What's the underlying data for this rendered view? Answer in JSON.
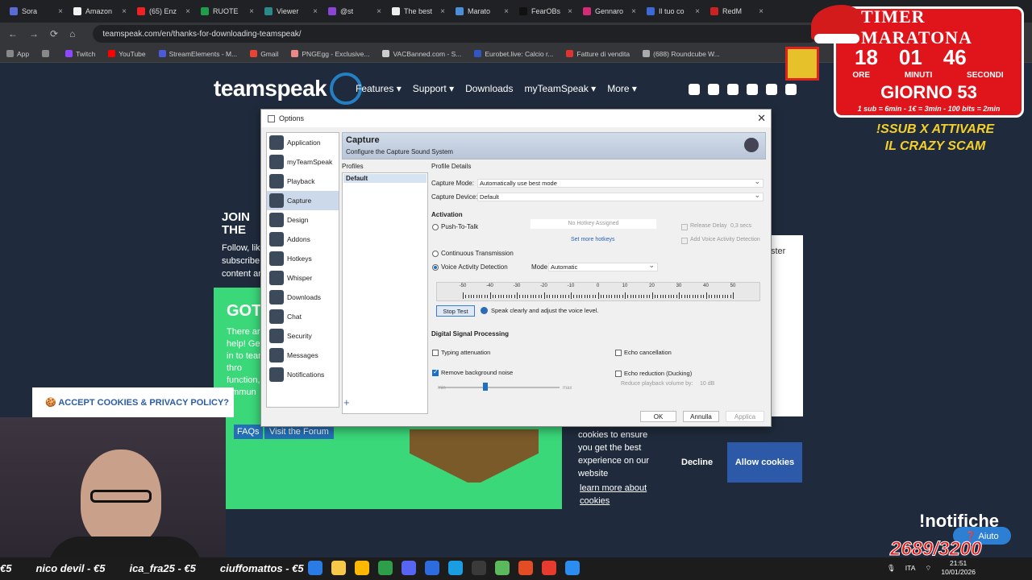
{
  "browser": {
    "tabs": [
      {
        "label": "Sora",
        "color": "#5a6bd8"
      },
      {
        "label": "Amazon",
        "color": "#f3f3f3"
      },
      {
        "label": "(65) Enz",
        "color": "#e22"
      },
      {
        "label": "RUOTE",
        "color": "#1e9e4a"
      },
      {
        "label": "Viewer",
        "color": "#2a8a8a"
      },
      {
        "label": "@st",
        "color": "#8c44d6"
      },
      {
        "label": "The best",
        "color": "#eee"
      },
      {
        "label": "Marato",
        "color": "#4a90d9"
      },
      {
        "label": "FearOBs",
        "color": "#111"
      },
      {
        "label": "Gennaro",
        "color": "#d62976"
      },
      {
        "label": "Il tuo co",
        "color": "#3b6ad6"
      },
      {
        "label": "RedM",
        "color": "#c22"
      }
    ],
    "url": "teamspeak.com/en/thanks-for-downloading-teamspeak/",
    "bookmarks": [
      {
        "label": "App",
        "color": "#888"
      },
      {
        "label": "",
        "color": "#888"
      },
      {
        "label": "Twitch",
        "color": "#9146ff"
      },
      {
        "label": "YouTube",
        "color": "#f00"
      },
      {
        "label": "StreamElements - M...",
        "color": "#4a5ad8"
      },
      {
        "label": "Gmail",
        "color": "#ea4335"
      },
      {
        "label": "PNGEgg - Exclusive...",
        "color": "#e88"
      },
      {
        "label": "VACBanned.com - S...",
        "color": "#ccc"
      },
      {
        "label": "Eurobet.live: Calcio r...",
        "color": "#3357c0"
      },
      {
        "label": "Fatture di vendita",
        "color": "#d33"
      },
      {
        "label": "(688) Roundcube W...",
        "color": "#aaa"
      }
    ]
  },
  "site": {
    "logo": "teamspeak",
    "nav": [
      "Features ▾",
      "Support ▾",
      "Downloads",
      "myTeamSpeak ▾",
      "More ▾"
    ],
    "join_title": "JOIN THE",
    "join_text": "Follow, like, subscribe content an",
    "got_title": "GOT A",
    "got_text": "There are help! Get in to team thro function, ommun",
    "faq_button": "FAQs",
    "forum_button": "Visit the Forum",
    "white_panel_text": "ster",
    "cookie_text": "cookies to ensure you get the best experience on our website",
    "cookie_link": "learn more about cookies",
    "decline": "Decline",
    "allow": "Allow cookies",
    "accept_banner": "🍪 ACCEPT COOKIES & PRIVACY POLICY?"
  },
  "dialog": {
    "title": "Options",
    "nav": [
      "Application",
      "myTeamSpeak",
      "Playback",
      "Capture",
      "Design",
      "Addons",
      "Hotkeys",
      "Whisper",
      "Downloads",
      "Chat",
      "Security",
      "Messages",
      "Notifications"
    ],
    "selected_nav": "Capture",
    "header_title": "Capture",
    "header_sub": "Configure the Capture Sound System",
    "profiles_label": "Profiles",
    "profiles": [
      "Default"
    ],
    "profile_details": "Profile Details",
    "capture_mode_label": "Capture Mode:",
    "capture_mode_value": "Automatically use best mode",
    "capture_device_label": "Capture Device:",
    "capture_device_value": "Default",
    "activation": "Activation",
    "push_to_talk": "Push-To-Talk",
    "no_hotkey": "No Hotkey Assigned",
    "set_more_hotkeys": "Set more hotkeys",
    "release_delay": "Release Delay",
    "release_delay_value": "0,3 secs",
    "add_vad": "Add Voice Activity Detection",
    "continuous": "Continuous Transmission",
    "vad": "Voice Activity Detection",
    "mode_label": "Mode",
    "mode_value": "Automatic",
    "meter_ticks": [
      "-50",
      "-40",
      "-30",
      "-20",
      "-10",
      "0",
      "10",
      "20",
      "30",
      "40",
      "50"
    ],
    "stop_test": "Stop Test",
    "speak_hint": "Speak clearly and adjust the voice level.",
    "dsp": "Digital Signal Processing",
    "typing_att": "Typing attenuation",
    "echo_cancel": "Echo cancellation",
    "remove_noise": "Remove background noise",
    "echo_reduction": "Echo reduction (Ducking)",
    "reduce_playback": "Reduce playback volume by:",
    "reduce_value": "10 dB",
    "slider_min": "min",
    "slider_max": "max",
    "ok": "OK",
    "cancel": "Annulla",
    "apply": "Applica"
  },
  "overlay": {
    "timer_title": "TIMER MARATONA",
    "hours": "18",
    "minutes": "01",
    "seconds": "46",
    "units": [
      "ORE",
      "MINUTI",
      "SECONDI"
    ],
    "day": "GIORNO 53",
    "rates": "1 sub = 6min - 1€ = 3min - 100 bits = 2min",
    "promo": "!SSUB X ATTIVARE IL CRAZY SCAM",
    "notifiche": "!notifiche",
    "aiuto": "❓ Aiuto",
    "counter": "2689/3200",
    "ticker": [
      "€5",
      "nico devil - €5",
      "ica_fra25 - €5",
      "ciuffomattos - €5"
    ]
  },
  "taskbar": {
    "lang": "ITA",
    "time": "21:51",
    "date": "10/01/2026",
    "icon_colors": [
      "#2a7be4",
      "#f7c948",
      "#ffb800",
      "#2e9e4a",
      "#5865f2",
      "#2d6cdf",
      "#1b9de2",
      "#3a3a3a",
      "#5cb85c",
      "#e34d26",
      "#e63b2e",
      "#2c8df0"
    ]
  }
}
